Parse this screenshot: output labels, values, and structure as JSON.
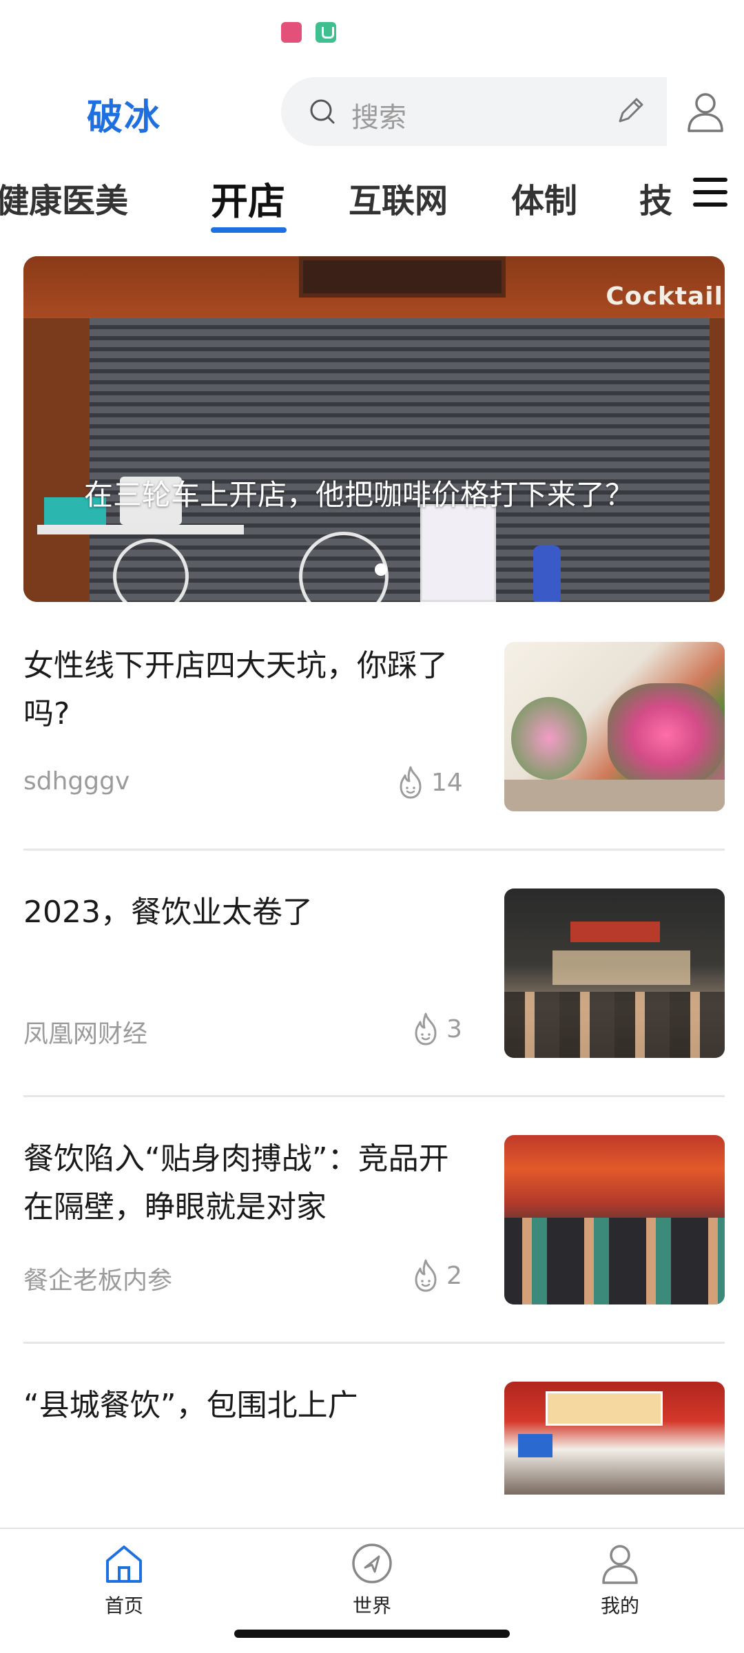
{
  "header": {
    "logo": "破冰",
    "search_placeholder": "搜索"
  },
  "tabs": [
    {
      "label": "健康医美"
    },
    {
      "label": "开店",
      "active": true
    },
    {
      "label": "互联网"
    },
    {
      "label": "体制"
    },
    {
      "label": "技"
    }
  ],
  "banner": {
    "title": "在三轮车上开店，他把咖啡价格打下来了？",
    "sign_text": "Cocktail"
  },
  "articles": [
    {
      "title": "女性线下开店四大天坑，你踩了吗?",
      "source": "sdhgggv",
      "heat": "14"
    },
    {
      "title": "2023，餐饮业太卷了",
      "source": "凤凰网财经",
      "heat": "3"
    },
    {
      "title": "餐饮陷入“贴身肉搏战”：竞品开在隔壁，睁眼就是对家",
      "source": "餐企老板内参",
      "heat": "2"
    },
    {
      "title": "“县城餐饮”，包围北上广",
      "source": "",
      "heat": ""
    }
  ],
  "bottom_nav": [
    {
      "label": "首页",
      "icon": "home-icon",
      "active": true
    },
    {
      "label": "世界",
      "icon": "compass-icon"
    },
    {
      "label": "我的",
      "icon": "person-icon"
    }
  ],
  "colors": {
    "accent": "#1e6fe0",
    "muted_text": "#9b9b9b"
  }
}
